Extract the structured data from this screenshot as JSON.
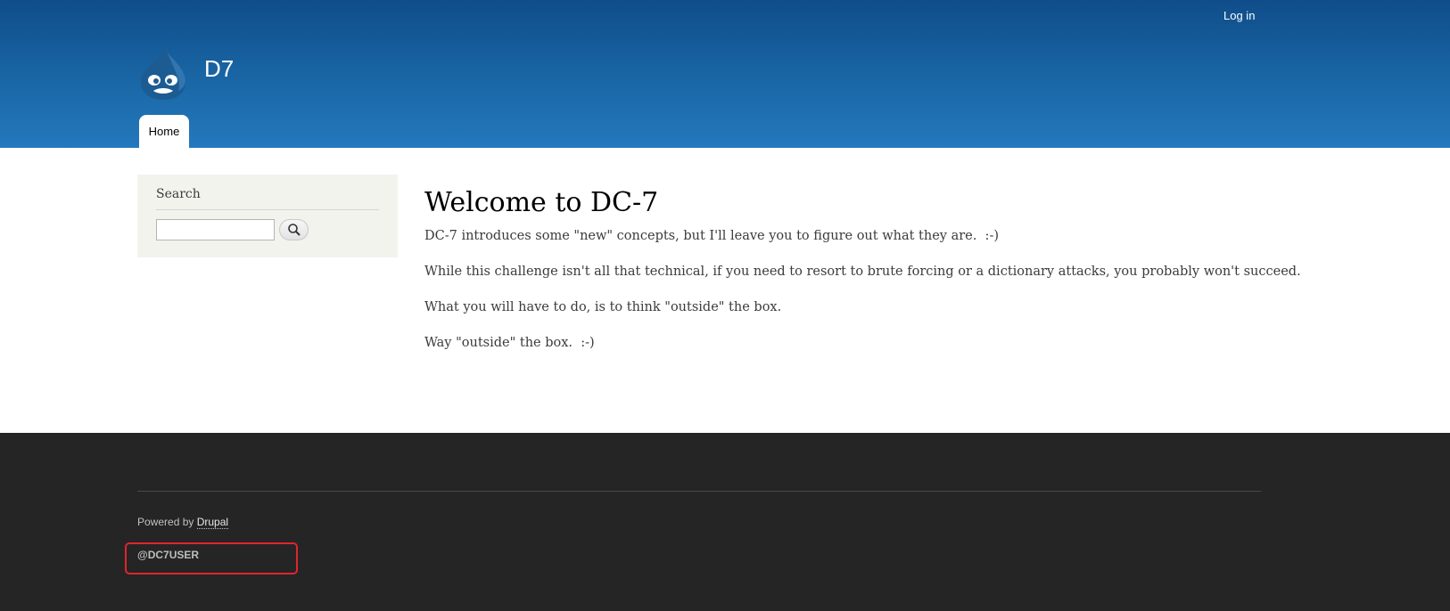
{
  "header": {
    "login_label": "Log in",
    "site_name": "D7",
    "logo_icon": "drupal-drop-icon",
    "nav": {
      "home_label": "Home"
    }
  },
  "sidebar": {
    "search_title": "Search",
    "search_input_value": "",
    "search_button_icon": "search-icon"
  },
  "main": {
    "title": "Welcome to DC-7",
    "paragraphs": [
      "DC-7 introduces some \"new\" concepts, but I'll leave you to figure out what they are.  :-)",
      "While this challenge isn't all that technical, if you need to resort to brute forcing or a dictionary attacks, you probably won't succeed.",
      "What you will have to do, is to think \"outside\" the box.",
      "Way \"outside\" the box.  :-)"
    ]
  },
  "footer": {
    "powered_prefix": "Powered by ",
    "powered_link": "Drupal",
    "username": "@DC7USER",
    "highlight_color": "#e0252d"
  },
  "colors": {
    "header_top": "#0f4d8a",
    "header_bottom": "#2478bd",
    "footer_bg": "#252525",
    "sidebar_bg": "#f3f3ee"
  }
}
